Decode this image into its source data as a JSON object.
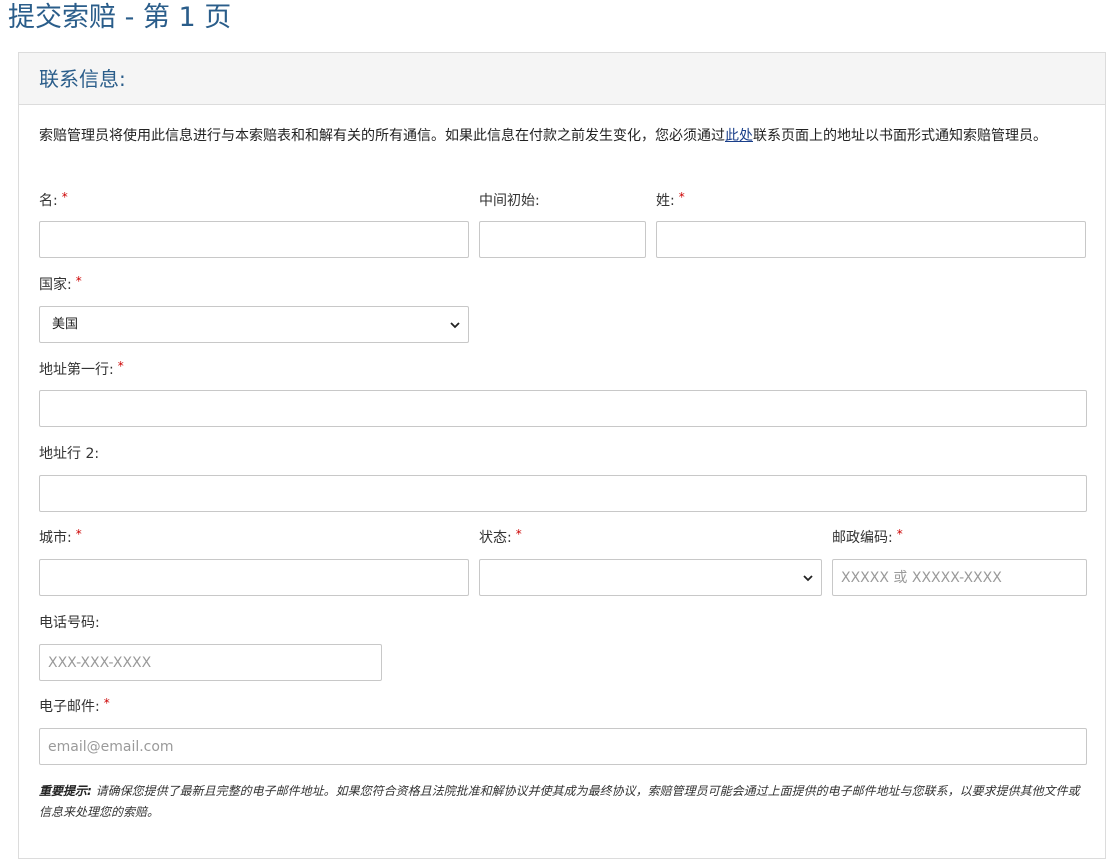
{
  "page": {
    "title": "提交索赔 - 第 1 页"
  },
  "section": {
    "title": "联系信息:",
    "intro_before": "索赔管理员将使用此信息进行与本索赔表和和解有关的所有通信。如果此信息在付款之前发生变化，您必须通过",
    "intro_link": "此处",
    "intro_after": "联系页面上的地址以书面形式通知索赔管理员。"
  },
  "fields": {
    "first_name": {
      "label": "名:",
      "required": "*",
      "value": ""
    },
    "middle_initial": {
      "label": "中间初始:",
      "value": ""
    },
    "last_name": {
      "label": "姓:",
      "required": "*",
      "value": ""
    },
    "country": {
      "label": "国家:",
      "required": "*",
      "value": "美国"
    },
    "address1": {
      "label": "地址第一行:",
      "required": "*",
      "value": ""
    },
    "address2": {
      "label": "地址行 2:",
      "value": ""
    },
    "city": {
      "label": "城市:",
      "required": "*",
      "value": ""
    },
    "state": {
      "label": "状态:",
      "required": "*",
      "value": ""
    },
    "zip": {
      "label": "邮政编码:",
      "required": "*",
      "placeholder": "XXXXX 或 XXXXX-XXXX",
      "value": ""
    },
    "phone": {
      "label": "电话号码:",
      "placeholder": "XXX-XXX-XXXX",
      "value": ""
    },
    "email": {
      "label": "电子邮件:",
      "required": "*",
      "placeholder": "email@email.com",
      "value": ""
    }
  },
  "note": {
    "bold": "重要提示:",
    "text": " 请确保您提供了最新且完整的电子邮件地址。如果您符合资格且法院批准和解协议并使其成为最终协议，索赔管理员可能会通过上面提供的电子邮件地址与您联系，以要求提供其他文件或信息来处理您的索赔。"
  },
  "colors": {
    "title": "#2a5d8a",
    "required": "#cc0000",
    "link": "#1a3f8a"
  }
}
